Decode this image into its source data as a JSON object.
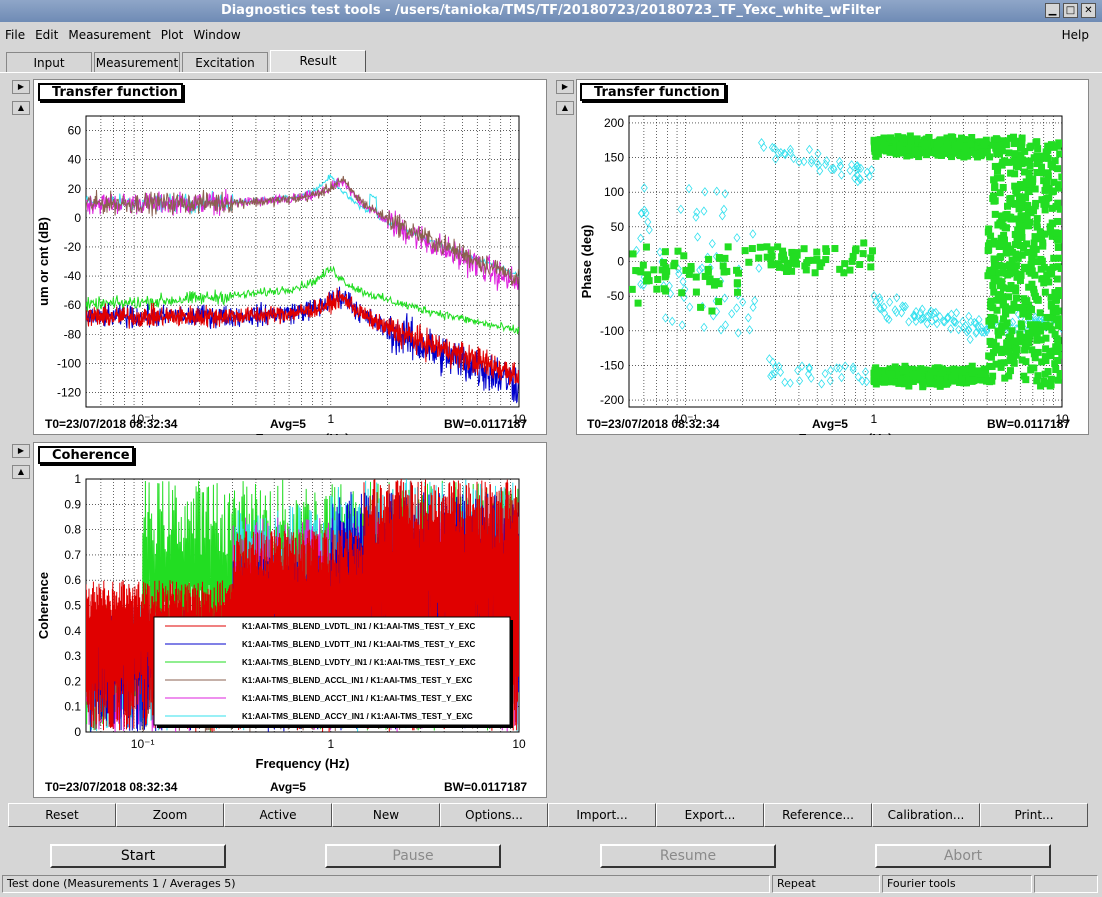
{
  "window": {
    "title": "Diagnostics test tools - /users/tanioka/TMS/TF/20180723/20180723_TF_Yexc_white_wFilter"
  },
  "menu": {
    "items": [
      "File",
      "Edit",
      "Measurement",
      "Plot",
      "Window"
    ],
    "help": "Help"
  },
  "tabs": [
    "Input",
    "Measurement",
    "Excitation",
    "Result"
  ],
  "active_tab": "Result",
  "plots": {
    "tf_mag": {
      "label": "Transfer function",
      "ylabel": "um or cnt (dB)",
      "xlabel": "Frequency (Hz)",
      "t0": "T0=23/07/2018 08:32:34",
      "avg": "Avg=5",
      "bw": "BW=0.0117187",
      "yticks": [
        "60",
        "40",
        "20",
        "0",
        "-20",
        "-40",
        "-60",
        "-80",
        "-100",
        "-120"
      ],
      "xticks": [
        "10-1",
        "1",
        "10"
      ]
    },
    "tf_phase": {
      "label": "Transfer function",
      "ylabel": "Phase (deg)",
      "xlabel": "Frequency (Hz)",
      "t0": "T0=23/07/2018 08:32:34",
      "avg": "Avg=5",
      "bw": "BW=0.0117187",
      "yticks": [
        "200",
        "150",
        "100",
        "50",
        "0",
        "-50",
        "-100",
        "-150",
        "-200"
      ],
      "xticks": [
        "10-1",
        "1",
        "10"
      ]
    },
    "coherence": {
      "label": "Coherence",
      "ylabel": "Coherence",
      "xlabel": "Frequency (Hz)",
      "t0": "T0=23/07/2018 08:32:34",
      "avg": "Avg=5",
      "bw": "BW=0.0117187",
      "yticks": [
        "1",
        "0.9",
        "0.8",
        "0.7",
        "0.6",
        "0.5",
        "0.4",
        "0.3",
        "0.2",
        "0.1",
        "0"
      ],
      "xticks": [
        "10-1",
        "1",
        "10"
      ]
    }
  },
  "legend": [
    {
      "name": "K1:AAI-TMS_BLEND_LVDTL_IN1 / K1:AAI-TMS_TEST_Y_EXC",
      "color": "#e00000"
    },
    {
      "name": "K1:AAI-TMS_BLEND_LVDTT_IN1 / K1:AAI-TMS_TEST_Y_EXC",
      "color": "#0000cc"
    },
    {
      "name": "K1:AAI-TMS_BLEND_LVDTY_IN1 / K1:AAI-TMS_TEST_Y_EXC",
      "color": "#22dd22"
    },
    {
      "name": "K1:AAI-TMS_BLEND_ACCL_IN1 / K1:AAI-TMS_TEST_Y_EXC",
      "color": "#8b6050"
    },
    {
      "name": "K1:AAI-TMS_BLEND_ACCT_IN1 / K1:AAI-TMS_TEST_Y_EXC",
      "color": "#dd22dd"
    },
    {
      "name": "K1:AAI-TMS_BLEND_ACCY_IN1 / K1:AAI-TMS_TEST_Y_EXC",
      "color": "#33e0ee"
    }
  ],
  "toolbar": [
    "Reset",
    "Zoom",
    "Active",
    "New",
    "Options...",
    "Import...",
    "Export...",
    "Reference...",
    "Calibration...",
    "Print..."
  ],
  "actions": {
    "start": "Start",
    "pause": "Pause",
    "resume": "Resume",
    "abort": "Abort"
  },
  "status": {
    "message": "Test done (Measurements 1 / Averages 5)",
    "mode": "Repeat",
    "tool": "Fourier tools"
  }
}
